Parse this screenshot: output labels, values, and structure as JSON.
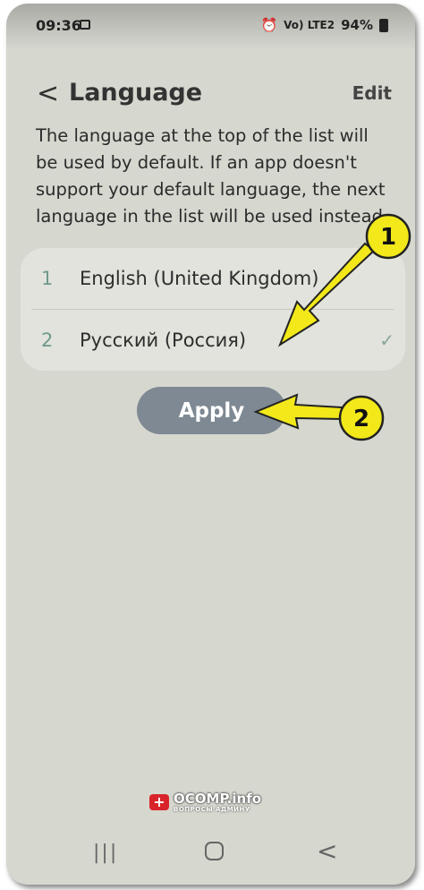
{
  "status_bar": {
    "time": "09:36",
    "signal_text": "Vo) LTE2",
    "battery": "94%"
  },
  "header": {
    "back_icon": "chevron-left-icon",
    "title": "Language",
    "edit_label": "Edit"
  },
  "description": "The language at the top of the list will be used by default. If an app doesn't support your default language, the next language in the list will be used instead.",
  "languages": [
    {
      "index": "1",
      "name": "English (United Kingdom)",
      "checked": false
    },
    {
      "index": "2",
      "name": "Русский (Россия)",
      "checked": true
    }
  ],
  "apply_label": "Apply",
  "annotations": [
    {
      "label": "1",
      "color": "#f2e81a"
    },
    {
      "label": "2",
      "color": "#f2e81a"
    }
  ],
  "watermark": {
    "title": "OCOMP.info",
    "subtitle": "ВОПРОСЫ АДМИНУ"
  },
  "nav_bar": {
    "icons": [
      "recent-apps-icon",
      "home-icon",
      "back-icon"
    ]
  },
  "colors": {
    "background": "#d6d7cf",
    "list_bg": "#e2e3dc",
    "apply_bg": "#7e8993",
    "index_accent": "#6e9a8c",
    "arrow_yellow": "#f2e81a"
  }
}
